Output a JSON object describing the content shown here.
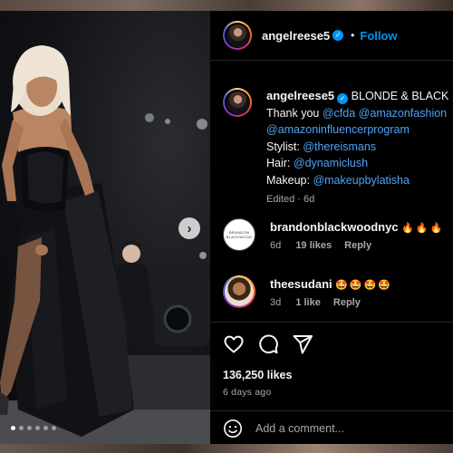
{
  "post": {
    "author": "angelreese5",
    "follow_label": "Follow",
    "separator": "•"
  },
  "caption": {
    "author": "angelreese5",
    "headline": "BLONDE & BLACK",
    "headline_mention_partial": "@",
    "thanks_prefix": "Thank you",
    "mentions_line1": [
      "@cfda",
      "@amazonfashion"
    ],
    "mentions_line2": "@amazoninfluencerprogram",
    "stylist_label": "Stylist:",
    "stylist": "@thereismans",
    "hair_label": "Hair:",
    "hair": "@dynamiclush",
    "makeup_label": "Makeup:",
    "makeup": "@makeupbylatisha",
    "edited": "Edited · 6d"
  },
  "comments": [
    {
      "user": "brandonblackwoodnyc",
      "text": "🔥🔥🔥",
      "age": "6d",
      "likes": "19 likes",
      "reply": "Reply",
      "avatar_text": "BRANDON BLACKWOOD"
    },
    {
      "user": "theesudani",
      "text": "🤩🤩🤩🤩",
      "age": "3d",
      "likes": "1 like",
      "reply": "Reply"
    }
  ],
  "stats": {
    "likes": "136,250 likes",
    "time_ago": "6 days ago"
  },
  "composer": {
    "placeholder": "Add a comment..."
  },
  "carousel": {
    "next_glyph": "›",
    "total_slides": 6,
    "active_slide": 1
  },
  "icons": [
    "heart-icon",
    "comment-icon",
    "share-icon",
    "emoji-icon",
    "verified-badge-icon",
    "chevron-right-icon"
  ]
}
